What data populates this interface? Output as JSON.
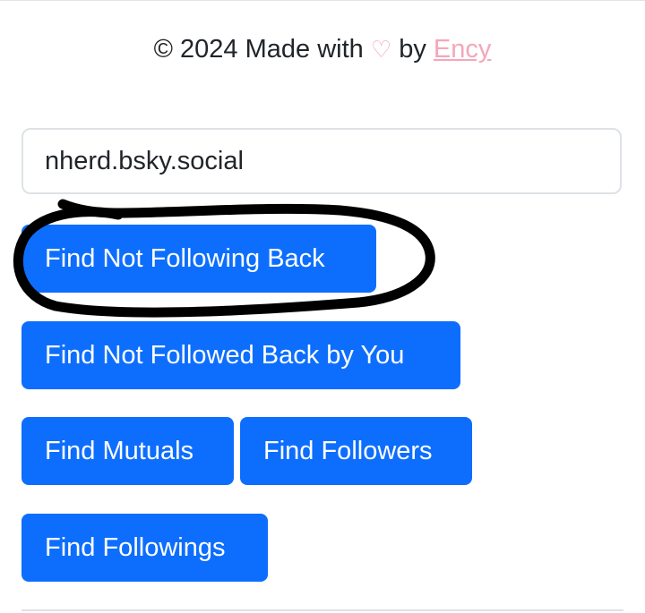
{
  "footer": {
    "prefix": "© 2024 Made with ",
    "heart": "♡",
    "by": " by ",
    "author_link": "Ency"
  },
  "search": {
    "value": "nherd.bsky.social",
    "placeholder": ""
  },
  "actions": {
    "not_following_back": "Find Not Following Back",
    "not_followed_back_by_you": "Find Not Followed Back by You",
    "mutuals": "Find Mutuals",
    "followers": "Find Followers",
    "followings": "Find Followings"
  },
  "colors": {
    "primary_button": "#0d6efd",
    "heart_and_link": "#f4a7b9",
    "annotation_marker": "#000000"
  },
  "annotation": {
    "type": "hand-drawn-circle",
    "target": "not_following_back"
  }
}
